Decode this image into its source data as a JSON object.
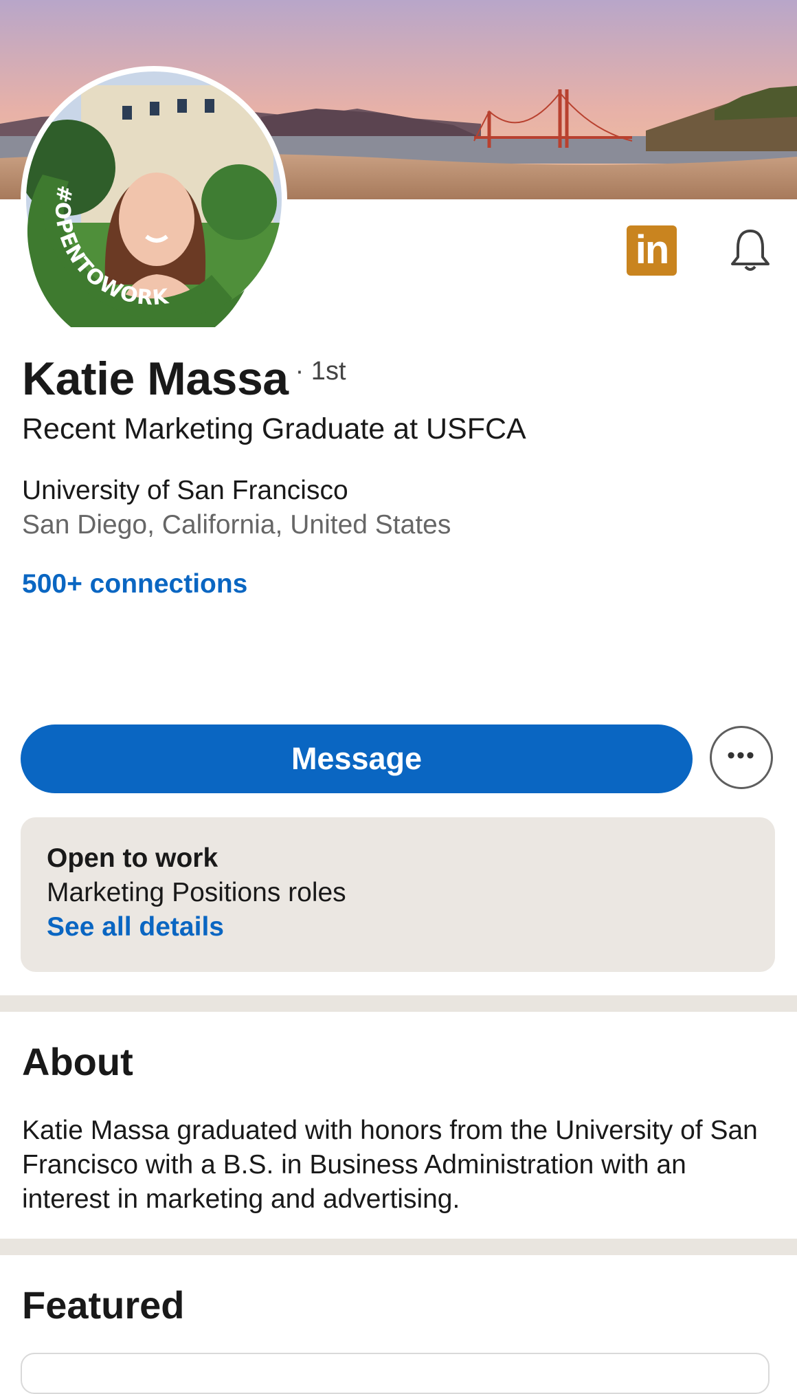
{
  "profile": {
    "name": "Katie Massa",
    "degree": "· 1st",
    "headline": "Recent Marketing Graduate at USFCA",
    "school": "University of San Francisco",
    "location": "San Diego, California, United States",
    "connections": "500+ connections",
    "open_to_work_frame": "#OPENTOWORK"
  },
  "header": {
    "linkedin_logo": "in",
    "icons": [
      "linkedin-icon",
      "bell-icon"
    ]
  },
  "actions": {
    "message_label": "Message",
    "more_label": "•••"
  },
  "open_to_work": {
    "title": "Open to work",
    "roles": "Marketing Positions roles",
    "link": "See all details"
  },
  "about": {
    "title": "About",
    "text": "Katie Massa graduated with honors from the University of San Francisco with a B.S. in Business Administration with an interest in marketing and advertising."
  },
  "featured": {
    "title": "Featured"
  },
  "colors": {
    "accent": "#0a66c2",
    "open_to_work_green": "#3e7a2f",
    "card_bg": "#ebe7e2",
    "logo_bg": "#c9841f"
  }
}
